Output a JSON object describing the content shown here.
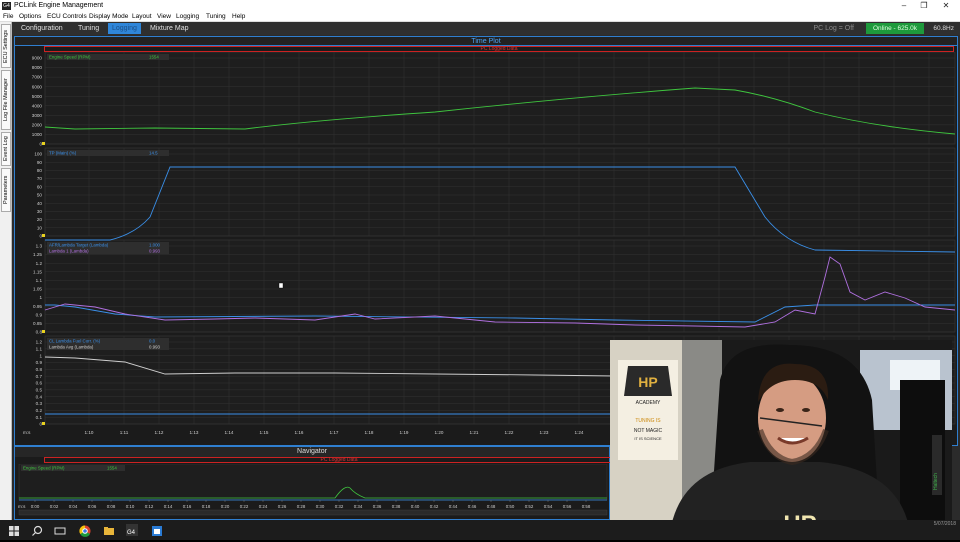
{
  "window": {
    "title": "PCLink Engine Management",
    "app_icon_text": "G4"
  },
  "menu": [
    "File",
    "Options",
    "ECU Controls",
    "Display Mode",
    "Layout",
    "View",
    "Logging",
    "Tuning",
    "Help"
  ],
  "side_tabs": [
    "ECU Settings",
    "Log File Manager",
    "Event Log",
    "Parameters"
  ],
  "main_tabs": [
    "Configuration",
    "Tuning",
    "Logging",
    "Mixture Map"
  ],
  "status": {
    "pc_log": "PC Log = Off",
    "online": "Online - 625.0k",
    "rate": "60.8Hz"
  },
  "timeplot": {
    "title": "Time Plot",
    "logged_label": "PC Logged Data",
    "x_unit": "m:s",
    "x_ticks": [
      "1:10",
      "1:11",
      "1:12",
      "1:13",
      "1:14",
      "1:15",
      "1:16",
      "1:17",
      "1:18",
      "1:19",
      "1:20",
      "1:21",
      "1:22",
      "1:23",
      "1:24"
    ],
    "panels": [
      {
        "labels": [
          {
            "name": "Engine Speed (RPM)",
            "value": "1554",
            "color": "#3fc53f"
          }
        ],
        "yticks": [
          "9000",
          "8000",
          "7000",
          "6000",
          "5000",
          "4000",
          "3000",
          "2000",
          "1000",
          "0"
        ]
      },
      {
        "labels": [
          {
            "name": "TP (Main) (%)",
            "value": "14.5",
            "color": "#3a8fe8"
          }
        ],
        "yticks": [
          "100",
          "90",
          "80",
          "70",
          "60",
          "50",
          "40",
          "30",
          "20",
          "10",
          "0"
        ]
      },
      {
        "labels": [
          {
            "name": "AFR/Lambda Target (Lambda)",
            "value": "1.000",
            "color": "#3a8fe8"
          },
          {
            "name": "Lambda 1 (Lambda)",
            "value": "0.993",
            "color": "#b070e0"
          }
        ],
        "yticks": [
          "1.3",
          "1.25",
          "1.2",
          "1.15",
          "1.1",
          "1.05",
          "1",
          "0.95",
          "0.9",
          "0.85",
          "0.8"
        ]
      },
      {
        "labels": [
          {
            "name": "CL Lambda Fuel Corr. (%)",
            "value": "0.0",
            "color": "#3a8fe8"
          },
          {
            "name": "Lambda Avg (Lambda)",
            "value": "0.993",
            "color": "#cfcfcf"
          }
        ],
        "yticks": [
          "1.2",
          "1.1",
          "1",
          "0.9",
          "0.8",
          "0.7",
          "0.6",
          "0.5",
          "0.4",
          "0.3",
          "0.2",
          "0.1",
          "0"
        ]
      }
    ]
  },
  "navigator": {
    "title": "Navigator",
    "logged_label": "PC Logged Data",
    "channel": "Engine Speed (RPM)",
    "channel_value": "1554",
    "x_unit": "m:s",
    "x_ticks": [
      "0:00",
      "0:02",
      "0:04",
      "0:06",
      "0:08",
      "0:10",
      "0:12",
      "0:14",
      "0:16",
      "0:18",
      "0:20",
      "0:22",
      "0:24",
      "0:26",
      "0:28",
      "0:30",
      "0:32",
      "0:34",
      "0:36",
      "0:38",
      "0:40",
      "0:42",
      "0:44",
      "0:46",
      "0:48",
      "0:50",
      "0:52",
      "0:54",
      "0:56",
      "0:58"
    ]
  },
  "pip": {
    "poster_brand": "HP",
    "poster_sub": "ACADEMY",
    "poster_line1": "TUNING IS",
    "poster_line2": "NOT MAGIC",
    "poster_line3": "IT IS SCIENCE",
    "shirt_text": "HP",
    "brand_side": "Haltech",
    "date": "5/07/2018"
  },
  "colors": {
    "accent": "#2f7fd0",
    "online": "#1e9a3c",
    "rpm": "#3fc53f",
    "tp": "#3a8fe8",
    "lambda": "#b070e0",
    "lambda_avg": "#cfcfcf"
  }
}
